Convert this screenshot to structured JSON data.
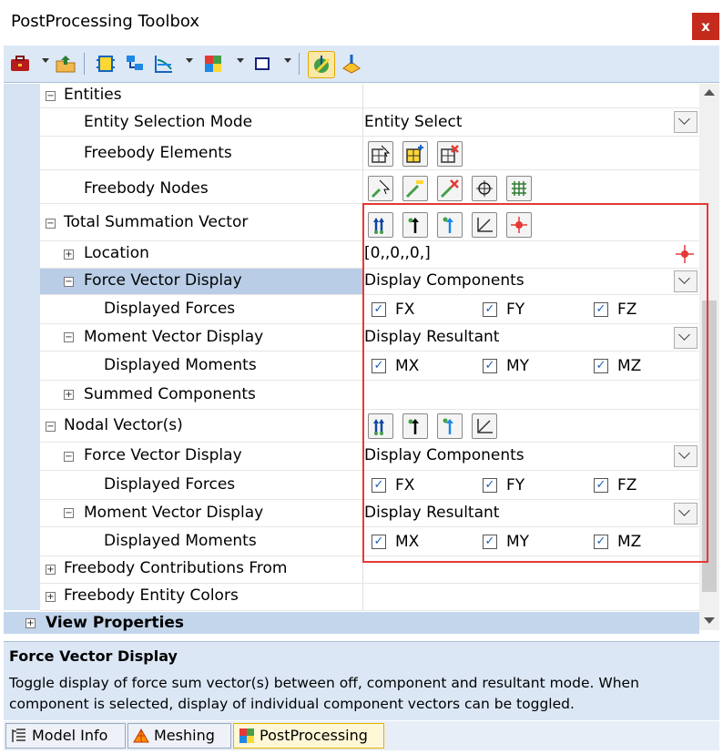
{
  "window": {
    "title": "PostProcessing Toolbox",
    "close": "x"
  },
  "toolbar": {
    "icons": [
      "toolbox-icon",
      "folder-upload-icon",
      "freebody-icon",
      "mesh-tree-icon",
      "graph-icon",
      "contour-icon",
      "view-box-icon",
      "freebody-active-icon",
      "freebody-display-icon"
    ]
  },
  "grid": {
    "entities": "Entities",
    "entity_selection_mode": {
      "label": "Entity Selection Mode",
      "value": "Entity Select"
    },
    "freebody_elements": "Freebody Elements",
    "freebody_nodes": "Freebody Nodes",
    "total_summation_vector": "Total Summation Vector",
    "location": {
      "label": "Location",
      "value": "[0,,0,,0,]"
    },
    "tsv_force_vector_display": {
      "label": "Force Vector Display",
      "value": "Display Components"
    },
    "tsv_displayed_forces": {
      "label": "Displayed Forces",
      "c1": "FX",
      "c2": "FY",
      "c3": "FZ"
    },
    "tsv_moment_vector_display": {
      "label": "Moment Vector Display",
      "value": "Display Resultant"
    },
    "tsv_displayed_moments": {
      "label": "Displayed Moments",
      "c1": "MX",
      "c2": "MY",
      "c3": "MZ"
    },
    "summed_components": "Summed Components",
    "nodal_vectors": "Nodal Vector(s)",
    "nv_force_vector_display": {
      "label": "Force Vector Display",
      "value": "Display Components"
    },
    "nv_displayed_forces": {
      "label": "Displayed Forces",
      "c1": "FX",
      "c2": "FY",
      "c3": "FZ"
    },
    "nv_moment_vector_display": {
      "label": "Moment Vector Display",
      "value": "Display Resultant"
    },
    "nv_displayed_moments": {
      "label": "Displayed Moments",
      "c1": "MX",
      "c2": "MY",
      "c3": "MZ"
    },
    "freebody_contributions_from": "Freebody Contributions From",
    "freebody_entity_colors": "Freebody Entity Colors",
    "view_properties": "View Properties"
  },
  "help": {
    "title": "Force Vector Display",
    "text": "Toggle display of force sum vector(s) between off, component and resultant mode. When component is selected, display of individual component vectors can be toggled."
  },
  "tabs": [
    {
      "label": "Model Info"
    },
    {
      "label": "Meshing"
    },
    {
      "label": "PostProcessing"
    }
  ],
  "colors": {
    "highlight_box": "#e53935",
    "close_bg": "#c42b1c",
    "selected_row": "#b9cde6"
  }
}
